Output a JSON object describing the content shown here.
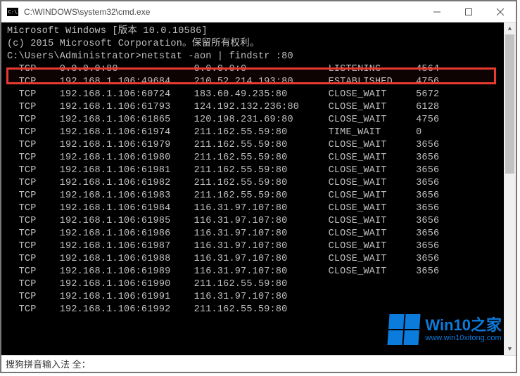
{
  "title": "C:\\WINDOWS\\system32\\cmd.exe",
  "header_lines": [
    "Microsoft Windows [版本 10.0.10586]",
    "(c) 2015 Microsoft Corporation。保留所有权利。",
    "",
    "C:\\Users\\Administrator>netstat -aon | findstr :80"
  ],
  "highlighted_row": {
    "proto": "TCP",
    "local": "0.0.0.0:80",
    "remote": "0.0.0.0:0",
    "state": "LISTENING",
    "pid": "4564"
  },
  "rows": [
    {
      "proto": "TCP",
      "local": "192.168.1.106:49684",
      "remote": "210.52.214.193:80",
      "state": "ESTABLISHED",
      "pid": "4756"
    },
    {
      "proto": "TCP",
      "local": "192.168.1.106:60724",
      "remote": "183.60.49.235:80",
      "state": "CLOSE_WAIT",
      "pid": "5672"
    },
    {
      "proto": "TCP",
      "local": "192.168.1.106:61793",
      "remote": "124.192.132.236:80",
      "state": "CLOSE_WAIT",
      "pid": "6128"
    },
    {
      "proto": "TCP",
      "local": "192.168.1.106:61865",
      "remote": "120.198.231.69:80",
      "state": "CLOSE_WAIT",
      "pid": "4756"
    },
    {
      "proto": "TCP",
      "local": "192.168.1.106:61974",
      "remote": "211.162.55.59:80",
      "state": "TIME_WAIT",
      "pid": "0"
    },
    {
      "proto": "TCP",
      "local": "192.168.1.106:61979",
      "remote": "211.162.55.59:80",
      "state": "CLOSE_WAIT",
      "pid": "3656"
    },
    {
      "proto": "TCP",
      "local": "192.168.1.106:61980",
      "remote": "211.162.55.59:80",
      "state": "CLOSE_WAIT",
      "pid": "3656"
    },
    {
      "proto": "TCP",
      "local": "192.168.1.106:61981",
      "remote": "211.162.55.59:80",
      "state": "CLOSE_WAIT",
      "pid": "3656"
    },
    {
      "proto": "TCP",
      "local": "192.168.1.106:61982",
      "remote": "211.162.55.59:80",
      "state": "CLOSE_WAIT",
      "pid": "3656"
    },
    {
      "proto": "TCP",
      "local": "192.168.1.106:61983",
      "remote": "211.162.55.59:80",
      "state": "CLOSE_WAIT",
      "pid": "3656"
    },
    {
      "proto": "TCP",
      "local": "192.168.1.106:61984",
      "remote": "116.31.97.107:80",
      "state": "CLOSE_WAIT",
      "pid": "3656"
    },
    {
      "proto": "TCP",
      "local": "192.168.1.106:61985",
      "remote": "116.31.97.107:80",
      "state": "CLOSE_WAIT",
      "pid": "3656"
    },
    {
      "proto": "TCP",
      "local": "192.168.1.106:61986",
      "remote": "116.31.97.107:80",
      "state": "CLOSE_WAIT",
      "pid": "3656"
    },
    {
      "proto": "TCP",
      "local": "192.168.1.106:61987",
      "remote": "116.31.97.107:80",
      "state": "CLOSE_WAIT",
      "pid": "3656"
    },
    {
      "proto": "TCP",
      "local": "192.168.1.106:61988",
      "remote": "116.31.97.107:80",
      "state": "CLOSE_WAIT",
      "pid": "3656"
    },
    {
      "proto": "TCP",
      "local": "192.168.1.106:61989",
      "remote": "116.31.97.107:80",
      "state": "CLOSE_WAIT",
      "pid": "3656"
    },
    {
      "proto": "TCP",
      "local": "192.168.1.106:61990",
      "remote": "211.162.55.59:80",
      "state": "",
      "pid": ""
    },
    {
      "proto": "TCP",
      "local": "192.168.1.106:61991",
      "remote": "116.31.97.107:80",
      "state": "",
      "pid": ""
    },
    {
      "proto": "TCP",
      "local": "192.168.1.106:61992",
      "remote": "211.162.55.59:80",
      "state": "",
      "pid": ""
    }
  ],
  "statusbar": "搜狗拼音输入法 全：",
  "watermark": {
    "title": "Win10之家",
    "url": "www.win10xitong.com"
  }
}
